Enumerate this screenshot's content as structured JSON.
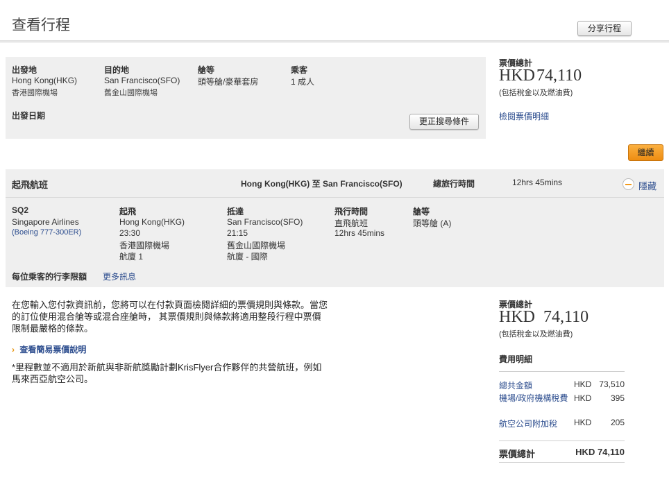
{
  "header": {
    "title": "查看行程",
    "share_label": "分享行程"
  },
  "search": {
    "origin_label": "出發地",
    "origin_value": "Hong Kong(HKG)",
    "origin_airport": "香港國際機場",
    "dest_label": "目的地",
    "dest_value": "San Francisco(SFO)",
    "dest_airport": "舊金山國際機場",
    "cabin_label": "艙等",
    "cabin_value": "頭等艙/豪華套房",
    "pax_label": "乘客",
    "pax_value": "1 成人",
    "date_label": "出發日期",
    "modify_label": "更正搜尋條件"
  },
  "price_top": {
    "label": "票價總計",
    "currency": "HKD",
    "amount": "74,110",
    "note": "(包括稅金以及燃油費)",
    "detail_link": "檢閱票價明細"
  },
  "continue_label": "繼續",
  "flight": {
    "section_title": "起飛航班",
    "route": "Hong Kong(HKG) 至 San Francisco(SFO)",
    "total_time_label": "總旅行時間",
    "total_time_value": "12hrs 45mins",
    "hide_label": "隱藏",
    "flight_no": "SQ2",
    "airline": "Singapore Airlines",
    "aircraft": "(Boeing 777-300ER)",
    "depart_label": "起飛",
    "depart_city": "Hong Kong(HKG)",
    "depart_time": "23:30",
    "depart_airport": "香港國際機場",
    "depart_terminal": "航廈 1",
    "arrive_label": "抵達",
    "arrive_city": "San Francisco(SFO)",
    "arrive_time": "21:15",
    "arrive_airport": "舊金山國際機場",
    "arrive_terminal": "航廈 - 國際",
    "duration_label": "飛行時間",
    "duration_type": "直飛航班",
    "duration_value": "12hrs 45mins",
    "cabin_label": "艙等",
    "cabin_value": "頭等艙 (A)",
    "baggage_label": "每位乘客的行李限額",
    "more_info": "更多訊息"
  },
  "notes": {
    "para1": "在您輸入您付款資訊前，您將可以在付款頁面檢閱詳細的票價規則與條款。當您的訂位使用混合艙等或混合座艙時， 其票價規則與條款將適用整段行程中票價限制最嚴格的條款。",
    "fare_link": "查看簡易票價說明",
    "para2": "*里程數並不適用於新航與非新航獎勵計劃KrisFlyer合作夥伴的共營航班，例如馬來西亞航空公司。"
  },
  "price_bottom": {
    "label": "票價總計",
    "currency": "HKD",
    "amount": "74,110",
    "note": "(包括稅金以及燃油費)",
    "breakdown_title": "費用明細",
    "rows": [
      {
        "label": "總共金額",
        "currency": "HKD",
        "amount": "73,510"
      },
      {
        "label": "機場/政府機構稅費",
        "currency": "HKD",
        "amount": "395"
      },
      {
        "label": "航空公司附加稅",
        "currency": "HKD",
        "amount": "205"
      }
    ],
    "total_label": "票價總計",
    "total_value": "HKD 74,110"
  }
}
